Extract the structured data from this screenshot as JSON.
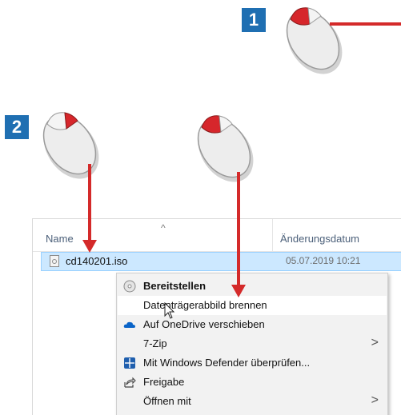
{
  "steps": {
    "step1": "1",
    "step2": "2"
  },
  "file_list": {
    "columns": {
      "name": "Name",
      "date": "Änderungsdatum"
    },
    "sort_indicator": "^",
    "file": {
      "name": "cd140201.iso",
      "date": "05.07.2019 10:21"
    }
  },
  "context_menu": {
    "items": [
      {
        "label": "Bereitstellen",
        "icon": "disc-icon"
      },
      {
        "label": "Datenträgerabbild brennen",
        "icon": ""
      },
      {
        "label": "Auf OneDrive verschieben",
        "icon": "onedrive-cloud-icon"
      },
      {
        "label": "7-Zip",
        "icon": "",
        "submenu": ">"
      },
      {
        "label": "Mit Windows Defender überprüfen...",
        "icon": "windows-defender-shield-icon"
      },
      {
        "label": "Freigabe",
        "icon": "share-icon"
      },
      {
        "label": "Öffnen mit",
        "icon": "",
        "submenu": ">"
      }
    ]
  },
  "colors": {
    "step_badge": "#1f6fb2",
    "arrow": "#d42a2a",
    "selection": "#cce8ff",
    "mouse_button": "#d6262b"
  }
}
